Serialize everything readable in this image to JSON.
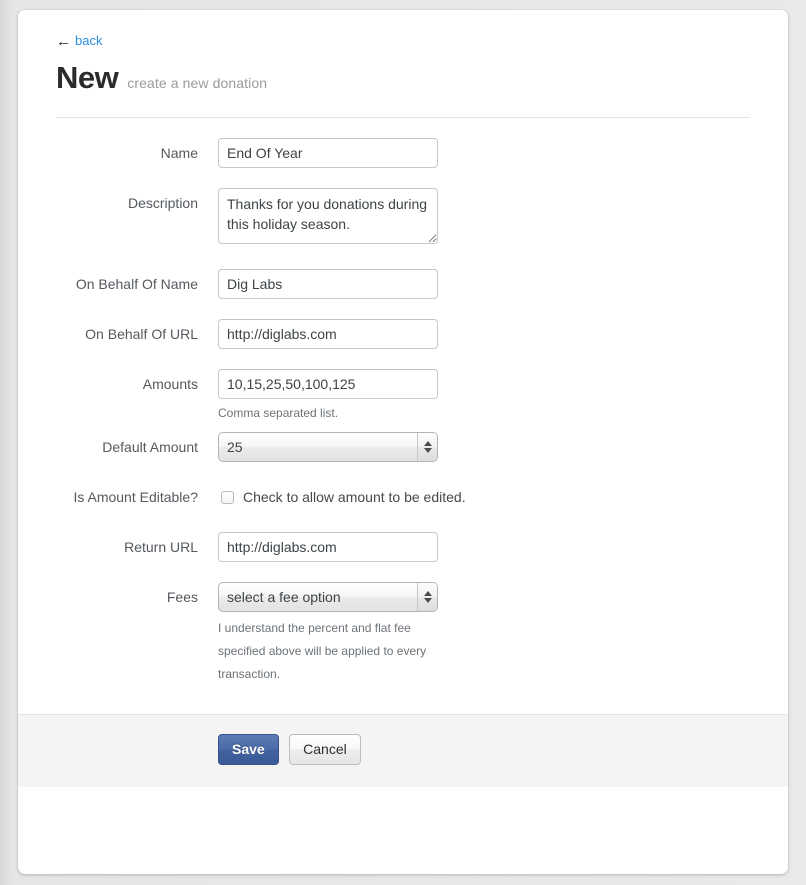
{
  "header": {
    "back_arrow": "←",
    "back_label": "back",
    "title": "New",
    "subtitle": "create a new donation"
  },
  "form": {
    "fields": [
      {
        "label": "Name",
        "type": "text",
        "value": "End Of Year",
        "placeholder": ""
      },
      {
        "label": "Description",
        "type": "textarea",
        "value": "Thanks for you donations during this holiday season.",
        "placeholder": ""
      },
      {
        "label": "On Behalf Of Name",
        "type": "text",
        "value": "Dig Labs",
        "placeholder": ""
      },
      {
        "label": "On Behalf Of URL",
        "type": "text",
        "value": "http://diglabs.com",
        "placeholder": ""
      },
      {
        "label": "Amounts",
        "type": "text",
        "value": "10,15,25,50,100,125",
        "placeholder": "",
        "help": "Comma separated list."
      },
      {
        "label": "Default Amount",
        "type": "select",
        "value": "25",
        "options": [
          "10",
          "15",
          "25",
          "50",
          "100",
          "125"
        ]
      },
      {
        "label": "Is Amount Editable?",
        "type": "checkbox",
        "checked": false,
        "checkbox_label": "Check to allow amount to be edited."
      },
      {
        "label": "Return URL",
        "type": "text",
        "value": "http://diglabs.com",
        "placeholder": ""
      },
      {
        "label": "Fees",
        "type": "select",
        "value": "select a fee option",
        "options": [
          "select a fee option"
        ],
        "help": "I understand the percent and flat fee specified above will be applied to every transaction."
      }
    ]
  },
  "footer": {
    "save_label": "Save",
    "cancel_label": "Cancel"
  },
  "colors": {
    "link": "#2b8fe0",
    "primary_button": "#4a6aa8",
    "page_background": "#e9e9e9",
    "card_background": "#ffffff",
    "footer_background": "#f4f4f4"
  }
}
